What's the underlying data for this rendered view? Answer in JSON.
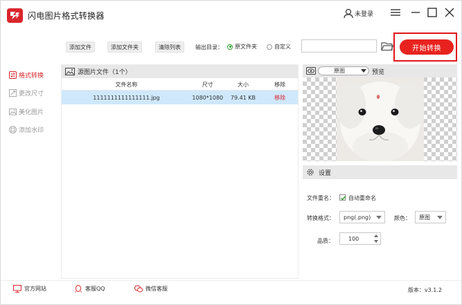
{
  "app": {
    "title": "闪电图片格式转换器",
    "user_label": "未登录"
  },
  "sidebar": {
    "items": [
      {
        "label": "格式转换",
        "icon": "swap-icon",
        "active": true
      },
      {
        "label": "更改尺寸",
        "icon": "resize-icon",
        "active": false
      },
      {
        "label": "美化图片",
        "icon": "image-icon",
        "active": false
      },
      {
        "label": "添加水印",
        "icon": "watermark-icon",
        "active": false
      }
    ]
  },
  "toolbar": {
    "add_file": "添加文件",
    "add_folder": "添加文件夹",
    "clear_list": "清除列表",
    "output_label": "输出目录：",
    "opt_source": "原文件夹",
    "opt_custom": "自定义",
    "path_value": "",
    "start_label": "开始转换"
  },
  "file_panel": {
    "title": "源图片文件（1个）",
    "columns": [
      "文件名称",
      "尺寸",
      "大小",
      "移除"
    ],
    "rows": [
      {
        "name": "1111111111111111.jpg",
        "dims": "1080*1080",
        "size": "79.41 KB",
        "remove": "移除"
      }
    ]
  },
  "preview": {
    "mode": "原图",
    "label": "预览"
  },
  "settings": {
    "title": "设置",
    "rename_label": "文件重名：",
    "auto_rename": "自动重命名",
    "format_label": "转换格式：",
    "format_value": "png(.png)",
    "color_label": "颜色：",
    "color_value": "原图",
    "quality_label": "品质：",
    "quality_value": "100"
  },
  "footer": {
    "website": "官方网站",
    "qq": "客服QQ",
    "wechat": "微信客服",
    "version": "版本：v3.1.2"
  },
  "colors": {
    "accent": "#e8231f",
    "selected_row": "#cfe8fb",
    "panel_header": "#e8e8e8"
  }
}
